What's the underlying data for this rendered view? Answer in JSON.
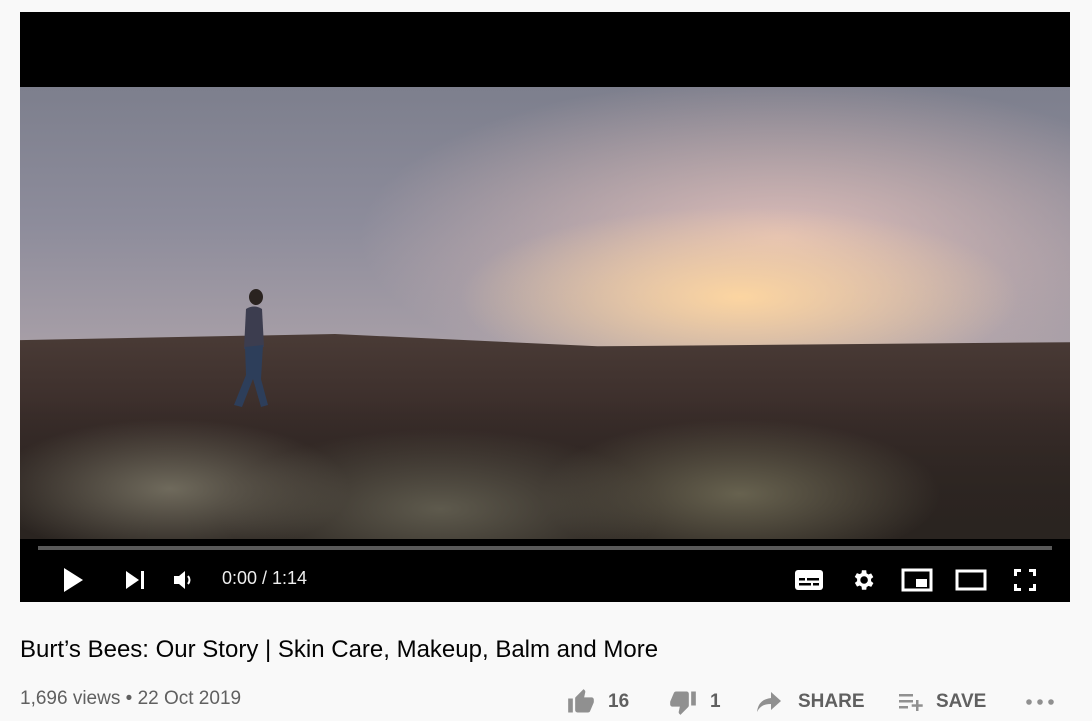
{
  "player": {
    "time_display": "0:00 / 1:14",
    "progress_fraction": 0.0,
    "progress_color": "#ff0000",
    "controls": [
      "play-icon",
      "next-icon",
      "volume-icon",
      "subtitles-icon",
      "settings-icon",
      "miniplayer-icon",
      "theater-mode-icon",
      "fullscreen-icon"
    ]
  },
  "video": {
    "title": "Burt’s Bees: Our Story | Skin Care, Makeup, Balm and More",
    "views": "1,696 views",
    "separator": "•",
    "date": "22 Oct 2019"
  },
  "actions": {
    "likes": "16",
    "dislikes": "1",
    "share_label": "SHARE",
    "save_label": "SAVE"
  }
}
